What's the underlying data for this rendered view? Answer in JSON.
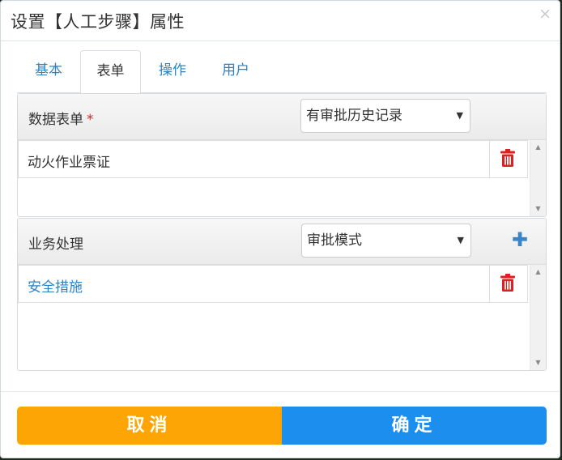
{
  "dialog": {
    "title": "设置【人工步骤】属性",
    "close_icon": "×"
  },
  "tabs": [
    {
      "label": "基本",
      "active": false
    },
    {
      "label": "表单",
      "active": true
    },
    {
      "label": "操作",
      "active": false
    },
    {
      "label": "用户",
      "active": false
    }
  ],
  "form_panel": {
    "label": "数据表单",
    "required_mark": "*",
    "select_value": "有审批历史记录",
    "rows": [
      {
        "text": "动火作业票证",
        "delete_icon": "trash-icon"
      }
    ]
  },
  "business_panel": {
    "label": "业务处理",
    "select_value": "审批模式",
    "add_icon": "plus-icon",
    "rows": [
      {
        "text": "安全措施",
        "delete_icon": "trash-icon"
      }
    ]
  },
  "footer": {
    "cancel_label": "取消",
    "ok_label": "确定"
  },
  "colors": {
    "accent_link": "#2d84c4",
    "cancel_button": "#fda505",
    "ok_button": "#1c8fee",
    "delete_icon": "#e02020"
  }
}
